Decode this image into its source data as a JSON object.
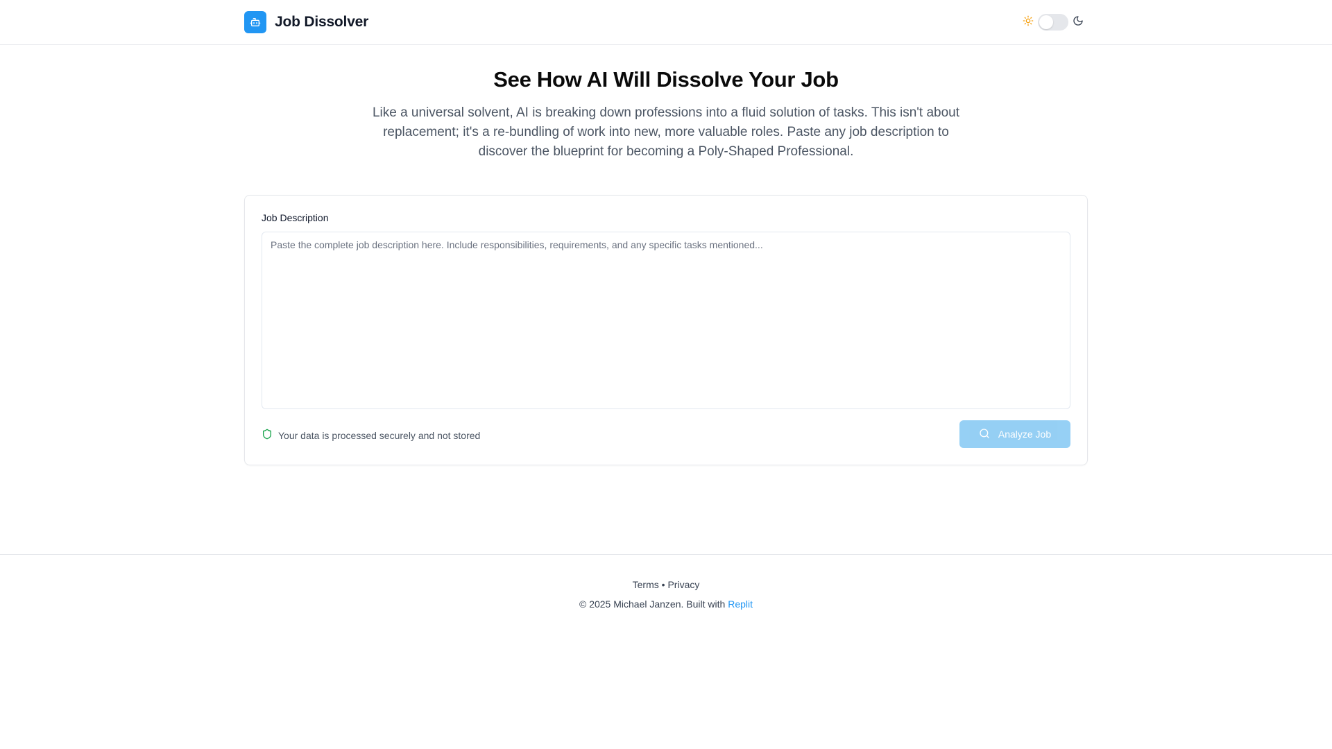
{
  "colors": {
    "accent": "#2196f3",
    "button_disabled": "#90cdf4",
    "shield_green": "#16a34a",
    "sun_amber": "#f59e0b"
  },
  "header": {
    "logo_icon": "bot-icon",
    "title": "Job Dissolver",
    "theme": {
      "light_icon": "sun-icon",
      "dark_icon": "moon-icon",
      "dark_mode": false
    }
  },
  "hero": {
    "title": "See How AI Will Dissolve Your Job",
    "description": "Like a universal solvent, AI is breaking down professions into a fluid solution of tasks. This isn't about replacement; it's a re-bundling of work into new, more valuable roles. Paste any job description to discover the blueprint for becoming a Poly-Shaped Professional."
  },
  "form": {
    "label": "Job Description",
    "textarea_value": "",
    "textarea_placeholder": "Paste the complete job description here. Include responsibilities, requirements, and any specific tasks mentioned...",
    "security_icon": "shield-icon",
    "security_note": "Your data is processed securely and not stored",
    "submit_icon": "search-icon",
    "submit_label": "Analyze Job"
  },
  "footer": {
    "terms": "Terms",
    "separator": "•",
    "privacy": "Privacy",
    "copyright_prefix": "© 2025 Michael Janzen. Built with",
    "built_with": "Replit"
  }
}
